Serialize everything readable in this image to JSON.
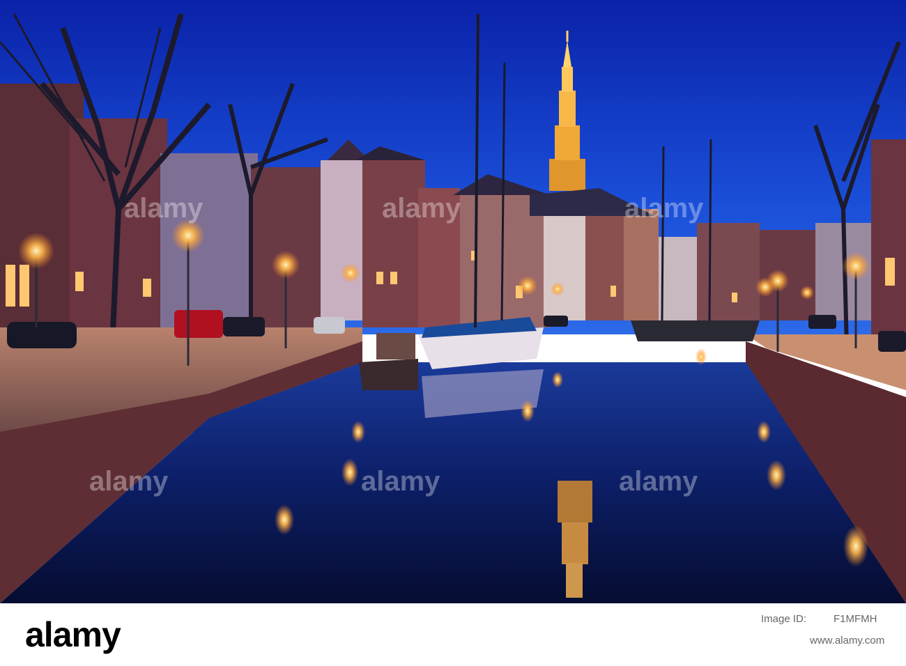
{
  "image": {
    "subject": "night view of a canal with moored sailing boats, lit street lamps, brick canal houses and an illuminated church tower reflected in the water",
    "palette": {
      "sky_top": "#0a2bb8",
      "sky_bottom": "#1e5de0",
      "water_dark": "#081030",
      "lamp_glow": "#ffb84a",
      "tower_gold": "#f0a030",
      "brick": "#6a3a3c"
    }
  },
  "watermark": {
    "text": "alamy"
  },
  "stock_bar": {
    "logo_text": "alamy",
    "image_id_label": "Image ID:",
    "image_id": "F1MFMH",
    "url": "www.alamy.com"
  }
}
